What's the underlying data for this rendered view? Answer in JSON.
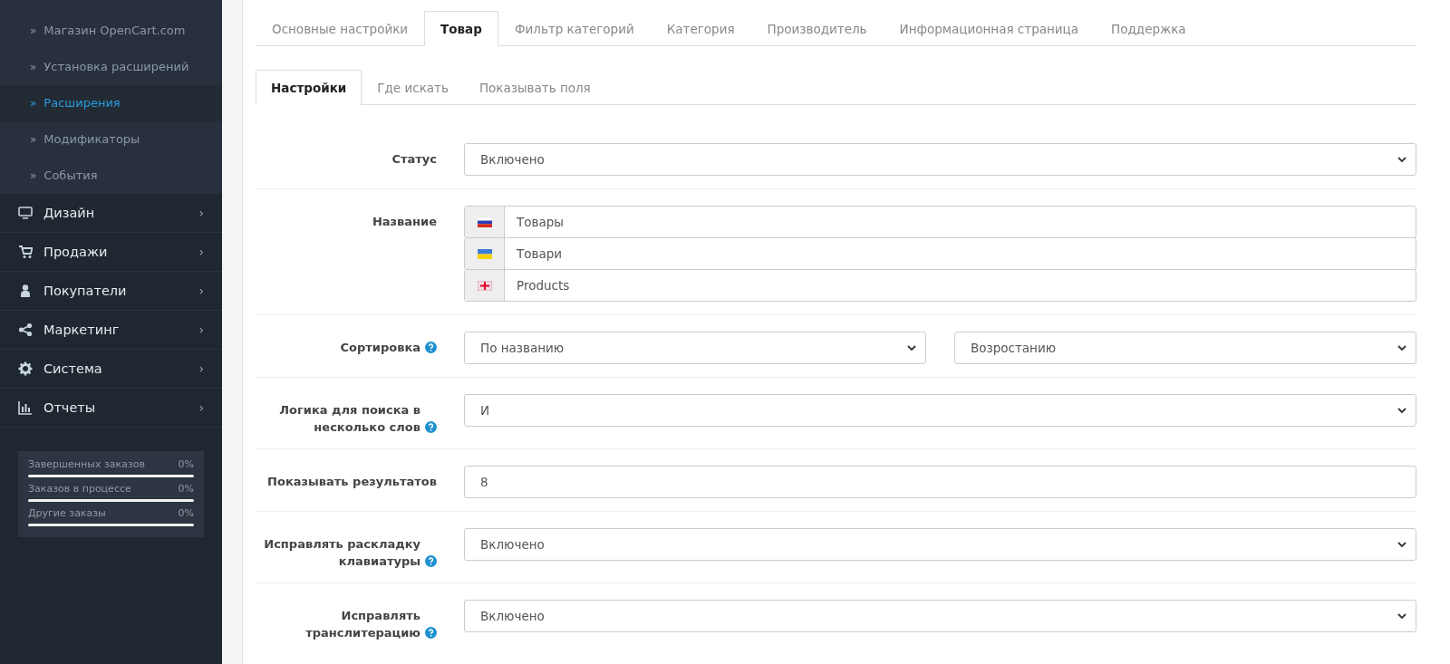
{
  "sidebar": {
    "sub_items": [
      {
        "bullet": "»",
        "label": "Магазин OpenCart.com",
        "selected": false
      },
      {
        "bullet": "»",
        "label": "Установка расширений",
        "selected": false
      },
      {
        "bullet": "»",
        "label": "Расширения",
        "selected": true
      },
      {
        "bullet": "»",
        "label": "Модификаторы",
        "selected": false
      },
      {
        "bullet": "»",
        "label": "События",
        "selected": false
      }
    ],
    "items": [
      {
        "label": "Дизайн",
        "arrow": "›"
      },
      {
        "label": "Продажи",
        "arrow": "›"
      },
      {
        "label": "Покупатели",
        "arrow": "›"
      },
      {
        "label": "Маркетинг",
        "arrow": "›"
      },
      {
        "label": "Система",
        "arrow": "›"
      },
      {
        "label": "Отчеты",
        "arrow": "›"
      }
    ],
    "stats": [
      {
        "label": "Завершенных заказов",
        "value": "0%",
        "level": 0
      },
      {
        "label": "Заказов в процессе",
        "value": "0%",
        "level": 0
      },
      {
        "label": "Другие заказы",
        "value": "0%",
        "level": 0
      }
    ]
  },
  "tabs": [
    {
      "label": "Основные настройки",
      "selected": false
    },
    {
      "label": "Товар",
      "selected": true
    },
    {
      "label": "Фильтр категорий",
      "selected": false
    },
    {
      "label": "Категория",
      "selected": false
    },
    {
      "label": "Производитель",
      "selected": false
    },
    {
      "label": "Информационная страница",
      "selected": false
    },
    {
      "label": "Поддержка",
      "selected": false
    }
  ],
  "subtabs": [
    {
      "label": "Настройки",
      "selected": true
    },
    {
      "label": "Где искать",
      "selected": false
    },
    {
      "label": "Показывать поля",
      "selected": false
    }
  ],
  "fields": [
    {
      "kind": "select",
      "label": "Статус",
      "help": false,
      "value": "Включено"
    },
    {
      "kind": "multilang",
      "label": "Название",
      "help": false,
      "values": [
        "Товары",
        "Товари",
        "Products"
      ]
    },
    {
      "kind": "select-pair",
      "label": "Сортировка",
      "help": true,
      "values": [
        "По названию",
        "Возростанию"
      ]
    },
    {
      "kind": "select",
      "label": "Логика для поиска в несколько слов",
      "help": true,
      "value": "И"
    },
    {
      "kind": "text",
      "label": "Показывать результатов",
      "help": false,
      "value": "8"
    },
    {
      "kind": "select",
      "label": "Исправлять раскладку клавиатуры",
      "help": true,
      "value": "Включено"
    },
    {
      "kind": "select",
      "label": "Исправлять транслитерацию",
      "help": true,
      "value": "Включено"
    }
  ]
}
